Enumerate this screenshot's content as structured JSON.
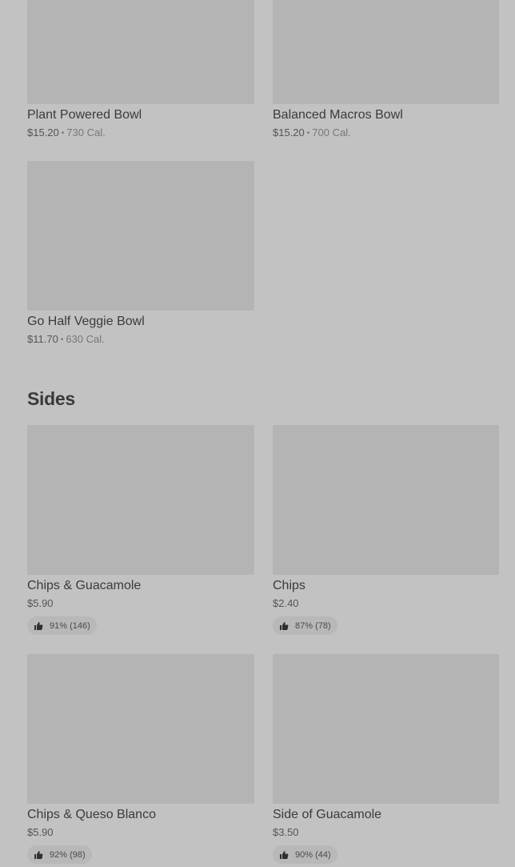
{
  "bowls": [
    {
      "name": "Plant Powered Bowl",
      "price": "$15.20",
      "separator": "•",
      "calories": "730 Cal."
    },
    {
      "name": "Balanced Macros Bowl",
      "price": "$15.20",
      "separator": "•",
      "calories": "700 Cal."
    },
    {
      "name": "Go Half Veggie Bowl",
      "price": "$11.70",
      "separator": "•",
      "calories": "630 Cal."
    }
  ],
  "sides": {
    "title": "Sides",
    "items": [
      {
        "name": "Chips & Guacamole",
        "price": "$5.90",
        "rating": "91% (146)"
      },
      {
        "name": "Chips",
        "price": "$2.40",
        "rating": "87% (78)"
      },
      {
        "name": "Chips & Queso Blanco",
        "price": "$5.90",
        "rating": "92% (98)"
      },
      {
        "name": "Side of Guacamole",
        "price": "$3.50",
        "rating": "90% (44)"
      }
    ]
  },
  "icons": {
    "rating": "thumbs-up-icon"
  },
  "colors": {
    "background": "#c2c2c2",
    "image_placeholder": "#b4b4b4",
    "badge": "#b8b8b8",
    "text": "#3a3a3a"
  }
}
